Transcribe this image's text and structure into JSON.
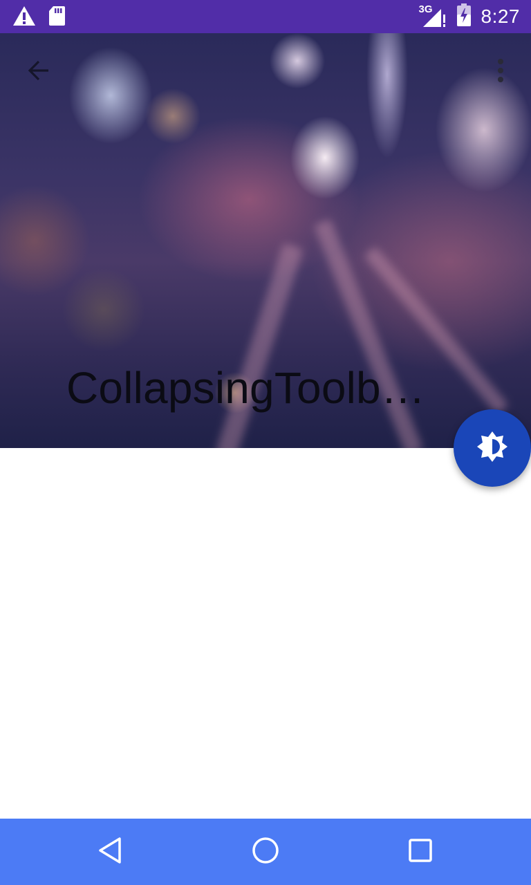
{
  "status_bar": {
    "time": "8:27",
    "network_label": "3G",
    "icons": [
      "warning-icon",
      "sd-card-icon",
      "signal-3g-icon",
      "battery-charging-icon"
    ],
    "background_color": "#512DA8"
  },
  "toolbar": {
    "back_icon": "arrow-back-icon",
    "overflow_icon": "more-vert-icon",
    "title": "CollapsingToolb…"
  },
  "fab": {
    "icon": "brightness-icon",
    "color": "#1A46B8"
  },
  "nav_bar": {
    "buttons": [
      "back-triangle-icon",
      "home-circle-icon",
      "recents-square-icon"
    ],
    "background_color": "#4C7BF5"
  }
}
